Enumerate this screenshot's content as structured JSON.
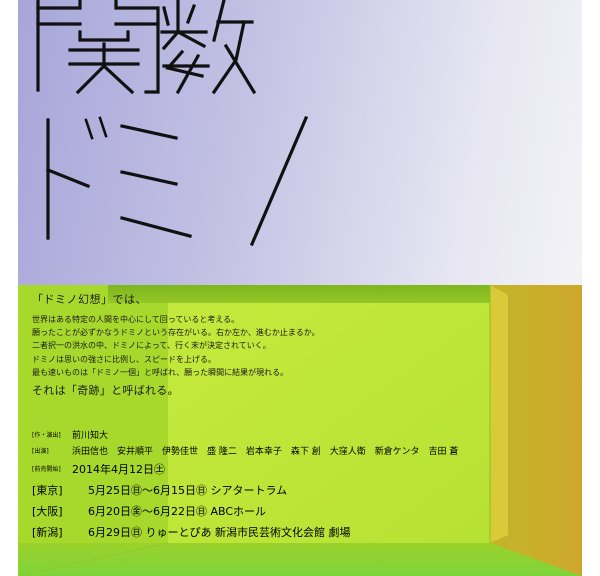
{
  "title": {
    "main": "関数",
    "sub": "ドミノ"
  },
  "intro": {
    "lead": "「ドミノ幻想」では、",
    "lines": [
      "世界はある特定の人間を中心にして回っていると考える。",
      "願ったことが必ずかなうドミノという存在がいる。右か左か、進むか止まるか。",
      "二者択一の洪水の中、ドミノによって、行く末が決定されていく。",
      "ドミノは思いの強さに比例し、スピードを上げる。",
      "最も速いものは「ドミノ一個」と呼ばれ、願った瞬間に結果が現れる。"
    ],
    "closing": "それは「奇跡」と呼ばれる。"
  },
  "credits": {
    "director_label": "[作・演出]",
    "director": "前川知大",
    "cast_label": "[出演]",
    "cast": "浜田信也　安井順平　伊勢佳世　盛 隆二　岩本幸子　森下 創　大窪人衛　新倉ケンタ　吉田 蒼"
  },
  "sales": {
    "label": "[前売開始]",
    "date": "2014年4月12日㊏"
  },
  "venues": [
    {
      "city": "[東京]",
      "detail": "5月25日㊐〜6月15日㊐ シアタートラム"
    },
    {
      "city": "[大阪]",
      "detail": "6月20日㊎〜6月22日㊐ ABCホール"
    },
    {
      "city": "[新潟]",
      "detail": "6月29日㊐ りゅーとぴあ 新潟市民芸術文化会館 劇場"
    }
  ],
  "colors": {
    "top_gradient_start": "#a8a6d9",
    "top_gradient_end": "#f3f3f7",
    "room_green": "#a4d52a",
    "room_right_wall": "#c8b52b",
    "text": "#1a1a1a"
  }
}
